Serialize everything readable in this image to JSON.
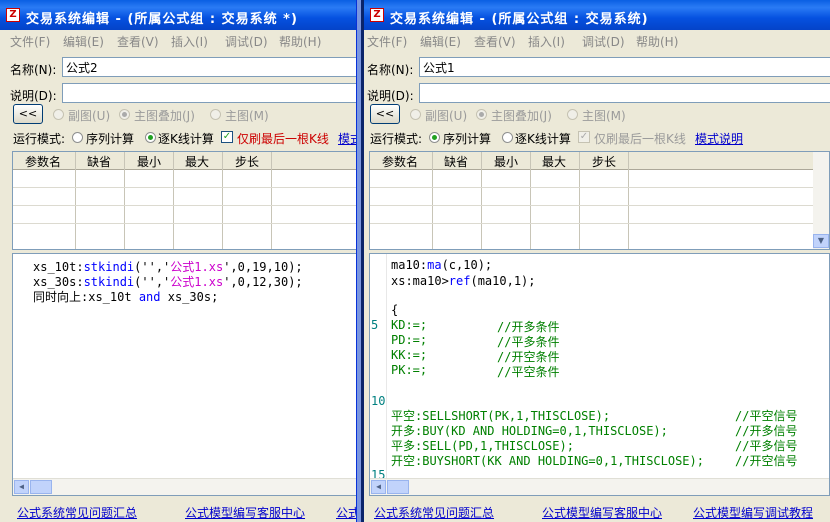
{
  "colors": {
    "accent": "#0a5fe3",
    "link": "#0000cc",
    "keyword": "#0000ff",
    "string": "#cc00cc",
    "comment": "#008000"
  },
  "left": {
    "title": "交易系统编辑 - (所属公式组 : 交易系统 *)",
    "menu": [
      "文件(F)",
      "编辑(E)",
      "查看(V)",
      "插入(I)",
      "调试(D)",
      "帮助(H)"
    ],
    "name_label": "名称(N):",
    "name_value": "公式2",
    "desc_label": "说明(D):",
    "desc_value": "",
    "collapse_label": "<<",
    "chart_radios": [
      "副图(U)",
      "主图叠加(J)",
      "主图(M)"
    ],
    "run_mode_label": "运行模式:",
    "mode_seq": "序列计算",
    "mode_kline": "逐K线计算",
    "last_bar_only": "仅刷最后一根K线",
    "mode_help": "模式说明",
    "params_headers": [
      "参数名",
      "缺省",
      "最小",
      "最大",
      "步长"
    ],
    "code": [
      {
        "a": "xs_10t:",
        "b": "stkindi",
        "c": "('','",
        "d": "公式1.xs",
        "e": "',0,19,10);"
      },
      {
        "a": "xs_30s:",
        "b": "stkindi",
        "c": "('','",
        "d": "公式1.xs",
        "e": "',0,12,30);"
      },
      {
        "a": "同时向上:xs_10t ",
        "b": "and",
        "c": " xs_30s;",
        "d": "",
        "e": ""
      }
    ],
    "footer_links": [
      "公式系统常见问题汇总",
      "公式模型编写客服中心",
      "公式"
    ]
  },
  "right": {
    "title": "交易系统编辑 - (所属公式组 : 交易系统)",
    "menu": [
      "文件(F)",
      "编辑(E)",
      "查看(V)",
      "插入(I)",
      "调试(D)",
      "帮助(H)"
    ],
    "name_label": "名称(N):",
    "name_value": "公式1",
    "desc_label": "说明(D):",
    "desc_value": "",
    "collapse_label": "<<",
    "chart_radios": [
      "副图(U)",
      "主图叠加(J)",
      "主图(M)"
    ],
    "run_mode_label": "运行模式:",
    "mode_seq": "序列计算",
    "mode_kline": "逐K线计算",
    "last_bar_only": "仅刷最后一根K线",
    "mode_help": "模式说明",
    "params_headers": [
      "参数名",
      "缺省",
      "最小",
      "最大",
      "步长"
    ],
    "line_numbers": [
      "5",
      "10",
      "15"
    ],
    "code": {
      "l1a": "ma10:",
      "l1b": "ma",
      "l1c": "(c,10);",
      "l2a": "xs:ma10>",
      "l2b": "ref",
      "l2c": "(ma10,1);",
      "l3": "{",
      "l4a": "KD:=;",
      "l4b": "//开多条件",
      "l5a": "PD:=;",
      "l5b": "//平多条件",
      "l6a": "KK:=;",
      "l6b": "//开空条件",
      "l7a": "PK:=;",
      "l7b": "//平空条件",
      "l8a": "平空:SELLSHORT(PK,1,THISCLOSE);",
      "l8b": "//平空信号",
      "l9a": "开多:BUY(KD AND HOLDING=0,1,THISCLOSE);",
      "l9b": "//开多信号",
      "l10a": "平多:SELL(PD,1,THISCLOSE);",
      "l10b": "//平多信号",
      "l11a": "开空:BUYSHORT(KK AND HOLDING=0,1,THISCLOSE);",
      "l11b": "//开空信号"
    },
    "footer_links": [
      "公式系统常见问题汇总",
      "公式模型编写客服中心",
      "公式模型编写调试教程"
    ]
  }
}
